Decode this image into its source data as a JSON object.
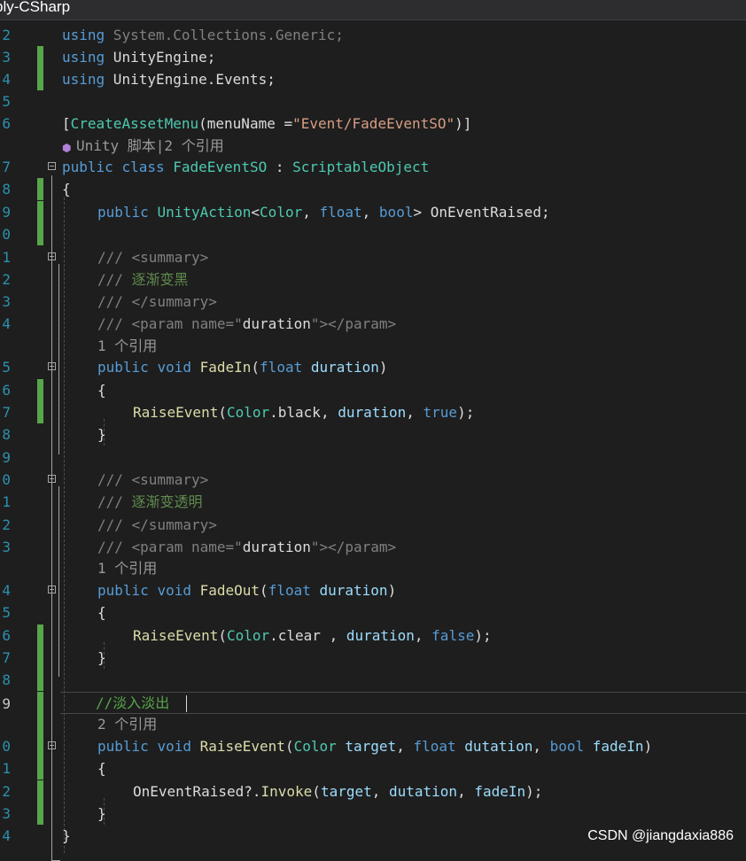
{
  "tab": {
    "title": "bly-CSharp"
  },
  "watermark": "CSDN @jiangdaxia886",
  "colors": {
    "background": "#1e1e1e",
    "keyword": "#569cd6",
    "type": "#4ec9b0",
    "comment": "#57a64a",
    "string": "#d69d85",
    "parameter": "#9cdcfe",
    "method": "#dcdcaa",
    "line_number": "#2b91af",
    "change_marker": "#57a64a"
  },
  "code": {
    "l2_num": "2",
    "l2_a": "using",
    "l2_b": " System.Collections.Generic;",
    "l3_num": "3",
    "l3_a": "using",
    "l3_b": " UnityEngine;",
    "l4_num": "4",
    "l4_a": "using",
    "l4_b": " UnityEngine.Events;",
    "l5_num": "5",
    "l6_num": "6",
    "l6_a": "[",
    "l6_b": "CreateAssetMenu",
    "l6_c": "(menuName =",
    "l6_d": "\"Event/FadeEventSO\"",
    "l6_e": ")]",
    "lens1_icon": "unity-cube-icon",
    "lens1": "Unity 脚本|2 个引用",
    "l7_num": "7",
    "l7_a": "public",
    "l7_b": " ",
    "l7_c": "class",
    "l7_d": " ",
    "l7_e": "FadeEventSO",
    "l7_f": " : ",
    "l7_g": "ScriptableObject",
    "l8_num": "8",
    "l8_a": "{",
    "l9_num": "9",
    "l9_a": "public",
    "l9_b": " ",
    "l9_c": "UnityAction",
    "l9_d": "<",
    "l9_e": "Color",
    "l9_f": ", ",
    "l9_g": "float",
    "l9_h": ", ",
    "l9_i": "bool",
    "l9_j": "> OnEventRaised;",
    "l10_num": "0",
    "l11_num": "1",
    "l11_a": "/// ",
    "l11_b": "<summary>",
    "l12_num": "2",
    "l12_a": "/// ",
    "l12_b": "逐渐变黑",
    "l13_num": "3",
    "l13_a": "/// ",
    "l13_b": "</summary>",
    "l14_num": "4",
    "l14_a": "/// ",
    "l14_b": "<param ",
    "l14_c": "name=",
    "l14_d": "\"",
    "l14_e": "duration",
    "l14_f": "\"",
    "l14_g": "></param>",
    "lens2": "1 个引用",
    "l15_num": "5",
    "l15_a": "public",
    "l15_b": " ",
    "l15_c": "void",
    "l15_d": " ",
    "l15_e": "FadeIn",
    "l15_f": "(",
    "l15_g": "float",
    "l15_h": " ",
    "l15_i": "duration",
    "l15_j": ")",
    "l16_num": "6",
    "l16_a": "{",
    "l17_num": "7",
    "l17_a": "RaiseEvent",
    "l17_b": "(",
    "l17_c": "Color",
    "l17_d": ".black, ",
    "l17_e": "duration",
    "l17_f": ", ",
    "l17_g": "true",
    "l17_h": ");",
    "l18_num": "8",
    "l18_a": "}",
    "l19_num": "9",
    "l20_num": "0",
    "l20_a": "/// ",
    "l20_b": "<summary>",
    "l21_num": "1",
    "l21_a": "/// ",
    "l21_b": "逐渐变透明",
    "l22_num": "2",
    "l22_a": "/// ",
    "l22_b": "</summary>",
    "l23_num": "3",
    "l23_a": "/// ",
    "l23_b": "<param ",
    "l23_c": "name=",
    "l23_d": "\"",
    "l23_e": "duration",
    "l23_f": "\"",
    "l23_g": "></param>",
    "lens3": "1 个引用",
    "l24_num": "4",
    "l24_a": "public",
    "l24_b": " ",
    "l24_c": "void",
    "l24_d": " ",
    "l24_e": "FadeOut",
    "l24_f": "(",
    "l24_g": "float",
    "l24_h": " ",
    "l24_i": "duration",
    "l24_j": ")",
    "l25_num": "5",
    "l25_a": "{",
    "l26_num": "6",
    "l26_a": "RaiseEvent",
    "l26_b": "(",
    "l26_c": "Color",
    "l26_d": ".clear , ",
    "l26_e": "duration",
    "l26_f": ", ",
    "l26_g": "false",
    "l26_h": ");",
    "l27_num": "7",
    "l27_a": "}",
    "l28_num": "8",
    "l29_num": "9",
    "l29_a": "//淡入淡出",
    "lens4": "2 个引用",
    "l30_num": "0",
    "l30_a": "public",
    "l30_b": " ",
    "l30_c": "void",
    "l30_d": " ",
    "l30_e": "RaiseEvent",
    "l30_f": "(",
    "l30_g": "Color",
    "l30_h": " ",
    "l30_i": "target",
    "l30_j": ", ",
    "l30_k": "float",
    "l30_l": " ",
    "l30_m": "dutation",
    "l30_n": ", ",
    "l30_o": "bool",
    "l30_p": " ",
    "l30_q": "fadeIn",
    "l30_r": ")",
    "l31_num": "1",
    "l31_a": "{",
    "l32_num": "2",
    "l32_a": "OnEventRaised?.",
    "l32_b": "Invoke",
    "l32_c": "(",
    "l32_d": "target",
    "l32_e": ", ",
    "l32_f": "dutation",
    "l32_g": ", ",
    "l32_h": "fadeIn",
    "l32_i": ");",
    "l33_num": "3",
    "l33_a": "}",
    "l34_num": "4",
    "l34_a": "}"
  }
}
